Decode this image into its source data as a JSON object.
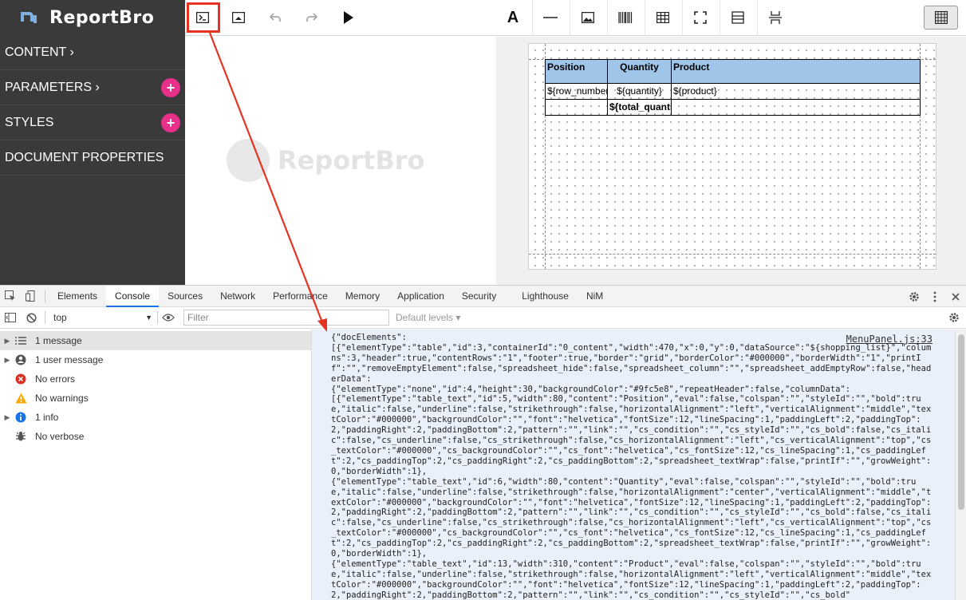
{
  "app": {
    "name": "ReportBro"
  },
  "sidebar": {
    "items": [
      {
        "label": "CONTENT ›",
        "has_add": false
      },
      {
        "label": "PARAMETERS ›",
        "has_add": true
      },
      {
        "label": "STYLES",
        "has_add": true
      },
      {
        "label": "DOCUMENT PROPERTIES",
        "has_add": false
      }
    ],
    "add_symbol": "+"
  },
  "toolbar": {
    "left_buttons": [
      "console-icon",
      "preview-icon",
      "undo-icon",
      "redo-icon",
      "play-icon"
    ],
    "right_buttons": [
      "text-icon",
      "line-icon",
      "image-icon",
      "barcode-icon",
      "table-icon",
      "frame-icon",
      "section-icon",
      "page-break-icon"
    ],
    "text_glyph": "A",
    "grid_toggle": "grid-icon"
  },
  "watermark": {
    "text": "ReportBro"
  },
  "doc_table": {
    "headers": [
      "Position",
      "Quantity",
      "Product"
    ],
    "content_row": [
      "${row_number}",
      "${quantity}",
      "${product}"
    ],
    "footer_row": [
      "",
      "${total_quantity}",
      ""
    ]
  },
  "devtools": {
    "tabs": [
      "Elements",
      "Console",
      "Sources",
      "Network",
      "Performance",
      "Memory",
      "Application",
      "Security",
      "Lighthouse",
      "NiM"
    ],
    "active_tab": "Console",
    "context": "top",
    "filter_placeholder": "Filter",
    "levels": "Default levels ▾",
    "sidebar": [
      {
        "label": "1 message",
        "icon": "list-icon",
        "expandable": true,
        "selected": true
      },
      {
        "label": "1 user message",
        "icon": "user-icon",
        "expandable": true,
        "selected": false
      },
      {
        "label": "No errors",
        "icon": "error-icon",
        "expandable": false,
        "selected": false
      },
      {
        "label": "No warnings",
        "icon": "warning-icon",
        "expandable": false,
        "selected": false
      },
      {
        "label": "1 info",
        "icon": "info-icon",
        "expandable": true,
        "selected": false
      },
      {
        "label": "No verbose",
        "icon": "bug-icon",
        "expandable": false,
        "selected": false
      }
    ],
    "log_source": "MenuPanel.js:33",
    "log_text": "{\"docElements\":\n[{\"elementType\":\"table\",\"id\":3,\"containerId\":\"0_content\",\"width\":470,\"x\":0,\"y\":0,\"dataSource\":\"${shopping_list}\",\"columns\":3,\"header\":true,\"contentRows\":\"1\",\"footer\":true,\"border\":\"grid\",\"borderColor\":\"#000000\",\"borderWidth\":\"1\",\"printIf\":\"\",\"removeEmptyElement\":false,\"spreadsheet_hide\":false,\"spreadsheet_column\":\"\",\"spreadsheet_addEmptyRow\":false,\"headerData\":\n{\"elementType\":\"none\",\"id\":4,\"height\":30,\"backgroundColor\":\"#9fc5e8\",\"repeatHeader\":false,\"columnData\":\n[{\"elementType\":\"table_text\",\"id\":5,\"width\":80,\"content\":\"Position\",\"eval\":false,\"colspan\":\"\",\"styleId\":\"\",\"bold\":true,\"italic\":false,\"underline\":false,\"strikethrough\":false,\"horizontalAlignment\":\"left\",\"verticalAlignment\":\"middle\",\"textColor\":\"#000000\",\"backgroundColor\":\"\",\"font\":\"helvetica\",\"fontSize\":12,\"lineSpacing\":1,\"paddingLeft\":2,\"paddingTop\":2,\"paddingRight\":2,\"paddingBottom\":2,\"pattern\":\"\",\"link\":\"\",\"cs_condition\":\"\",\"cs_styleId\":\"\",\"cs_bold\":false,\"cs_italic\":false,\"cs_underline\":false,\"cs_strikethrough\":false,\"cs_horizontalAlignment\":\"left\",\"cs_verticalAlignment\":\"top\",\"cs_textColor\":\"#000000\",\"cs_backgroundColor\":\"\",\"cs_font\":\"helvetica\",\"cs_fontSize\":12,\"cs_lineSpacing\":1,\"cs_paddingLeft\":2,\"cs_paddingTop\":2,\"cs_paddingRight\":2,\"cs_paddingBottom\":2,\"spreadsheet_textWrap\":false,\"printIf\":\"\",\"growWeight\":0,\"borderWidth\":1},\n{\"elementType\":\"table_text\",\"id\":6,\"width\":80,\"content\":\"Quantity\",\"eval\":false,\"colspan\":\"\",\"styleId\":\"\",\"bold\":true,\"italic\":false,\"underline\":false,\"strikethrough\":false,\"horizontalAlignment\":\"center\",\"verticalAlignment\":\"middle\",\"textColor\":\"#000000\",\"backgroundColor\":\"\",\"font\":\"helvetica\",\"fontSize\":12,\"lineSpacing\":1,\"paddingLeft\":2,\"paddingTop\":2,\"paddingRight\":2,\"paddingBottom\":2,\"pattern\":\"\",\"link\":\"\",\"cs_condition\":\"\",\"cs_styleId\":\"\",\"cs_bold\":false,\"cs_italic\":false,\"cs_underline\":false,\"cs_strikethrough\":false,\"cs_horizontalAlignment\":\"left\",\"cs_verticalAlignment\":\"top\",\"cs_textColor\":\"#000000\",\"cs_backgroundColor\":\"\",\"cs_font\":\"helvetica\",\"cs_fontSize\":12,\"cs_lineSpacing\":1,\"cs_paddingLeft\":2,\"cs_paddingTop\":2,\"cs_paddingRight\":2,\"cs_paddingBottom\":2,\"spreadsheet_textWrap\":false,\"printIf\":\"\",\"growWeight\":0,\"borderWidth\":1},\n{\"elementType\":\"table_text\",\"id\":13,\"width\":310,\"content\":\"Product\",\"eval\":false,\"colspan\":\"\",\"styleId\":\"\",\"bold\":true,\"italic\":false,\"underline\":false,\"strikethrough\":false,\"horizontalAlignment\":\"left\",\"verticalAlignment\":\"middle\",\"textColor\":\"#000000\",\"backgroundColor\":\"\",\"font\":\"helvetica\",\"fontSize\":12,\"lineSpacing\":1,\"paddingLeft\":2,\"paddingTop\":2,\"paddingRight\":2,\"paddingBottom\":2,\"pattern\":\"\",\"link\":\"\",\"cs_condition\":\"\",\"cs_styleId\":\"\",\"cs_bold\"",
    "colors": {
      "log_bg": "#e9f0fa",
      "accent": "#1a73e8",
      "error": "#d93025",
      "warning": "#f9ab00",
      "info": "#1a73e8"
    }
  },
  "colors": {
    "sidebar_bg": "#3a3a3a",
    "plus_button": "#e8308a",
    "table_header": "#9fc5e8",
    "highlight": "#e53323"
  }
}
